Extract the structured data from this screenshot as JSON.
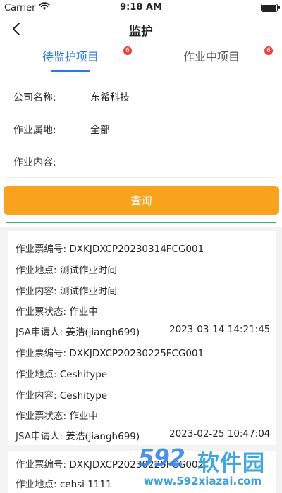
{
  "status_bar": {
    "carrier": "Carrier",
    "time": "9:18 AM"
  },
  "nav": {
    "title": "监护"
  },
  "tabs": [
    {
      "label": "待监护项目",
      "badge": "6",
      "active": true
    },
    {
      "label": "作业中项目",
      "badge": "6",
      "active": false
    }
  ],
  "filters": {
    "company": {
      "label": "公司名称:",
      "value": "东希科技"
    },
    "location": {
      "label": "作业属地:",
      "value": "全部"
    },
    "content": {
      "label": "作业内容:",
      "value": ""
    }
  },
  "query_button": "查询",
  "labels": {
    "ticket_no": "作业票编号:",
    "site": "作业地点:",
    "content": "作业内容:",
    "status": "作业票状态:",
    "applicant": "JSA申请人:"
  },
  "records": [
    {
      "ticket_no": "DXKJDXCP20230314FCG001",
      "site": "测试作业时间",
      "content": "测试作业时间",
      "status": "作业中",
      "applicant": "姜浩(jiangh699)",
      "time": "2023-03-14 14:21:45"
    },
    {
      "ticket_no": "DXKJDXCP20230225FCG001",
      "site": "Ceshitype",
      "content": "Ceshitype",
      "status": "作业中",
      "applicant": "姜浩(jiangh699)",
      "time": "2023-02-25 10:47:04"
    },
    {
      "ticket_no": "DXKJDXCP20230225FCG002",
      "site": "cehsi 1111"
    }
  ],
  "watermark": {
    "logo": "592",
    "name": "软件园",
    "url": "www.592xiazai.com"
  },
  "colors": {
    "accent": "#2b7ae8",
    "badge": "#f23a3a",
    "button": "#f9a21e",
    "divider": "#2db872"
  }
}
